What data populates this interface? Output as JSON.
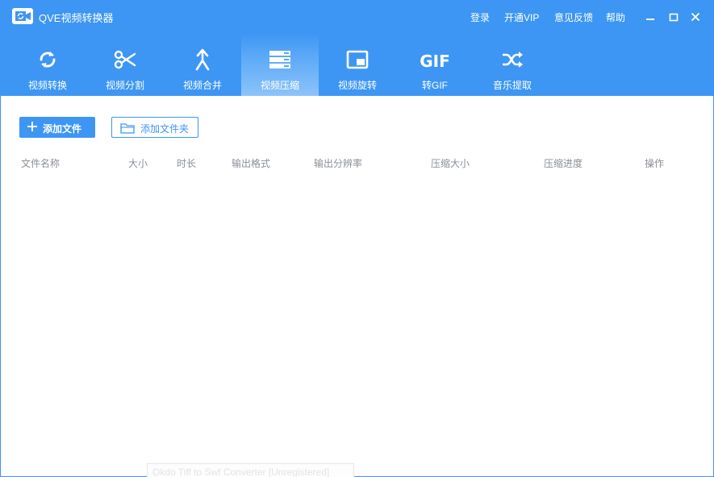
{
  "app": {
    "title": "QVE视频转换器",
    "logo_icon": "video-convert-logo-icon"
  },
  "topbar": {
    "links": {
      "login": "登录",
      "vip": "开通VIP",
      "feedback": "意见反馈",
      "help": "帮助"
    },
    "window_controls": [
      "minimize-icon",
      "maximize-icon",
      "close-icon"
    ]
  },
  "toolbar": {
    "items": [
      {
        "label": "视频转换",
        "icon": "refresh-icon",
        "active": false
      },
      {
        "label": "视频分割",
        "icon": "scissors-icon",
        "active": false
      },
      {
        "label": "视频合并",
        "icon": "merge-icon",
        "active": false
      },
      {
        "label": "视频压缩",
        "icon": "compress-icon",
        "active": true
      },
      {
        "label": "视频旋转",
        "icon": "rotate-screen-icon",
        "active": false
      },
      {
        "label": "转GIF",
        "icon": "gif-icon",
        "icon_text": "GIF",
        "active": false
      },
      {
        "label": "音乐提取",
        "icon": "shuffle-icon",
        "active": false
      }
    ]
  },
  "actions": {
    "add_file": "添加文件",
    "add_folder": "添加文件夹"
  },
  "table": {
    "columns": [
      "文件名称",
      "大小",
      "时长",
      "输出格式",
      "输出分辨率",
      "压缩大小",
      "压缩进度",
      "操作"
    ]
  },
  "ghost_tooltip": "Okdo Tiff to Swf Converter [Unregistered]",
  "colors": {
    "brand": "#3d96f4",
    "header_text": "#8a8f96",
    "background": "#ffffff"
  }
}
